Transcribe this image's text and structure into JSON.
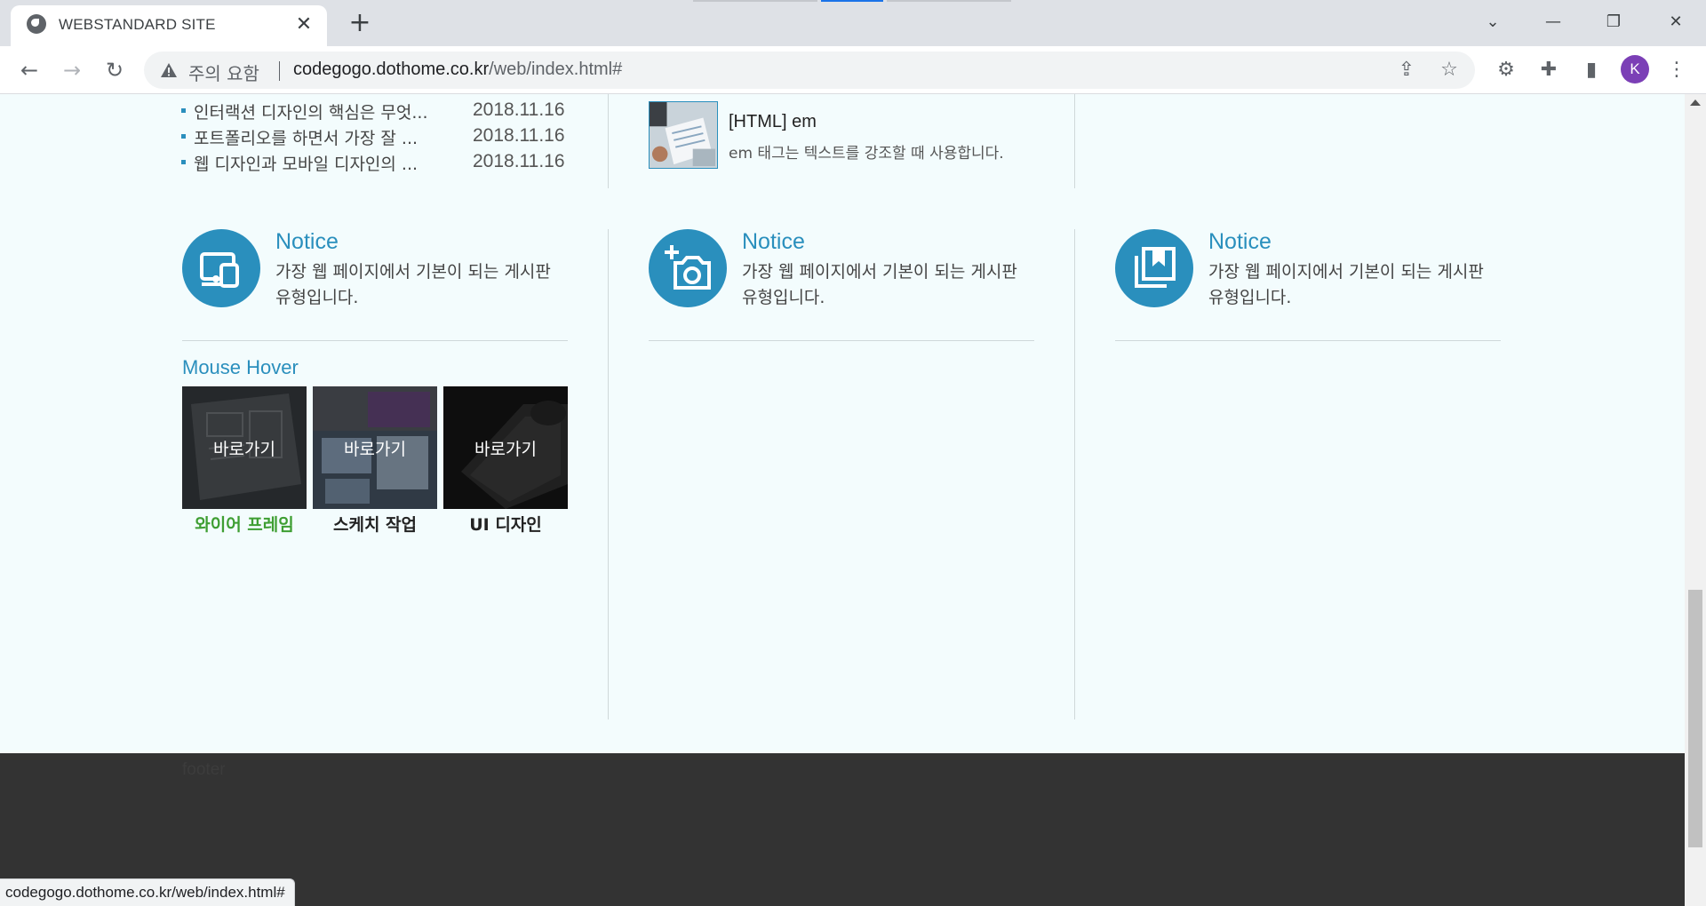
{
  "browser": {
    "tab_title": "WEBSTANDARD SITE",
    "security_label": "주의 요함",
    "url_host": "codegogo.dothome.co.kr",
    "url_path": "/web/index.html#",
    "avatar_letter": "K",
    "status_url": "codegogo.dothome.co.kr/web/index.html#"
  },
  "news": {
    "items": [
      {
        "title": "인터랙션 디자인의 핵심은 무엇...",
        "date": "2018.11.16"
      },
      {
        "title": "포트폴리오를 하면서 가장 잘 ...",
        "date": "2018.11.16"
      },
      {
        "title": "웹 디자인과 모바일 디자인의 ...",
        "date": "2018.11.16"
      }
    ]
  },
  "thumb_post": {
    "title": "[HTML] em",
    "desc": "em 태그는 텍스트를 강조할 때 사용합니다."
  },
  "notices": [
    {
      "title": "Notice",
      "desc": "가장 웹 페이지에서 기본이 되는 게시판 유형입니다.",
      "icon": "devices-icon"
    },
    {
      "title": "Notice",
      "desc": "가장 웹 페이지에서 기본이 되는 게시판 유형입니다.",
      "icon": "add-camera-icon"
    },
    {
      "title": "Notice",
      "desc": "가장 웹 페이지에서 기본이 되는 게시판 유형입니다.",
      "icon": "bookmarks-icon"
    }
  ],
  "mouse_hover": {
    "title": "Mouse Hover",
    "cards": [
      {
        "overlay": "바로가기",
        "caption": "와이어 프레임"
      },
      {
        "overlay": "바로가기",
        "caption": "스케치 작업"
      },
      {
        "overlay": "바로가기",
        "caption": "UI 디자인"
      }
    ]
  },
  "footer": {
    "text": "footer"
  },
  "colors": {
    "accent": "#2a8fbd",
    "active_caption": "#3e9e32",
    "footer_bg": "#333333",
    "page_bg": "#f3fcfd"
  }
}
